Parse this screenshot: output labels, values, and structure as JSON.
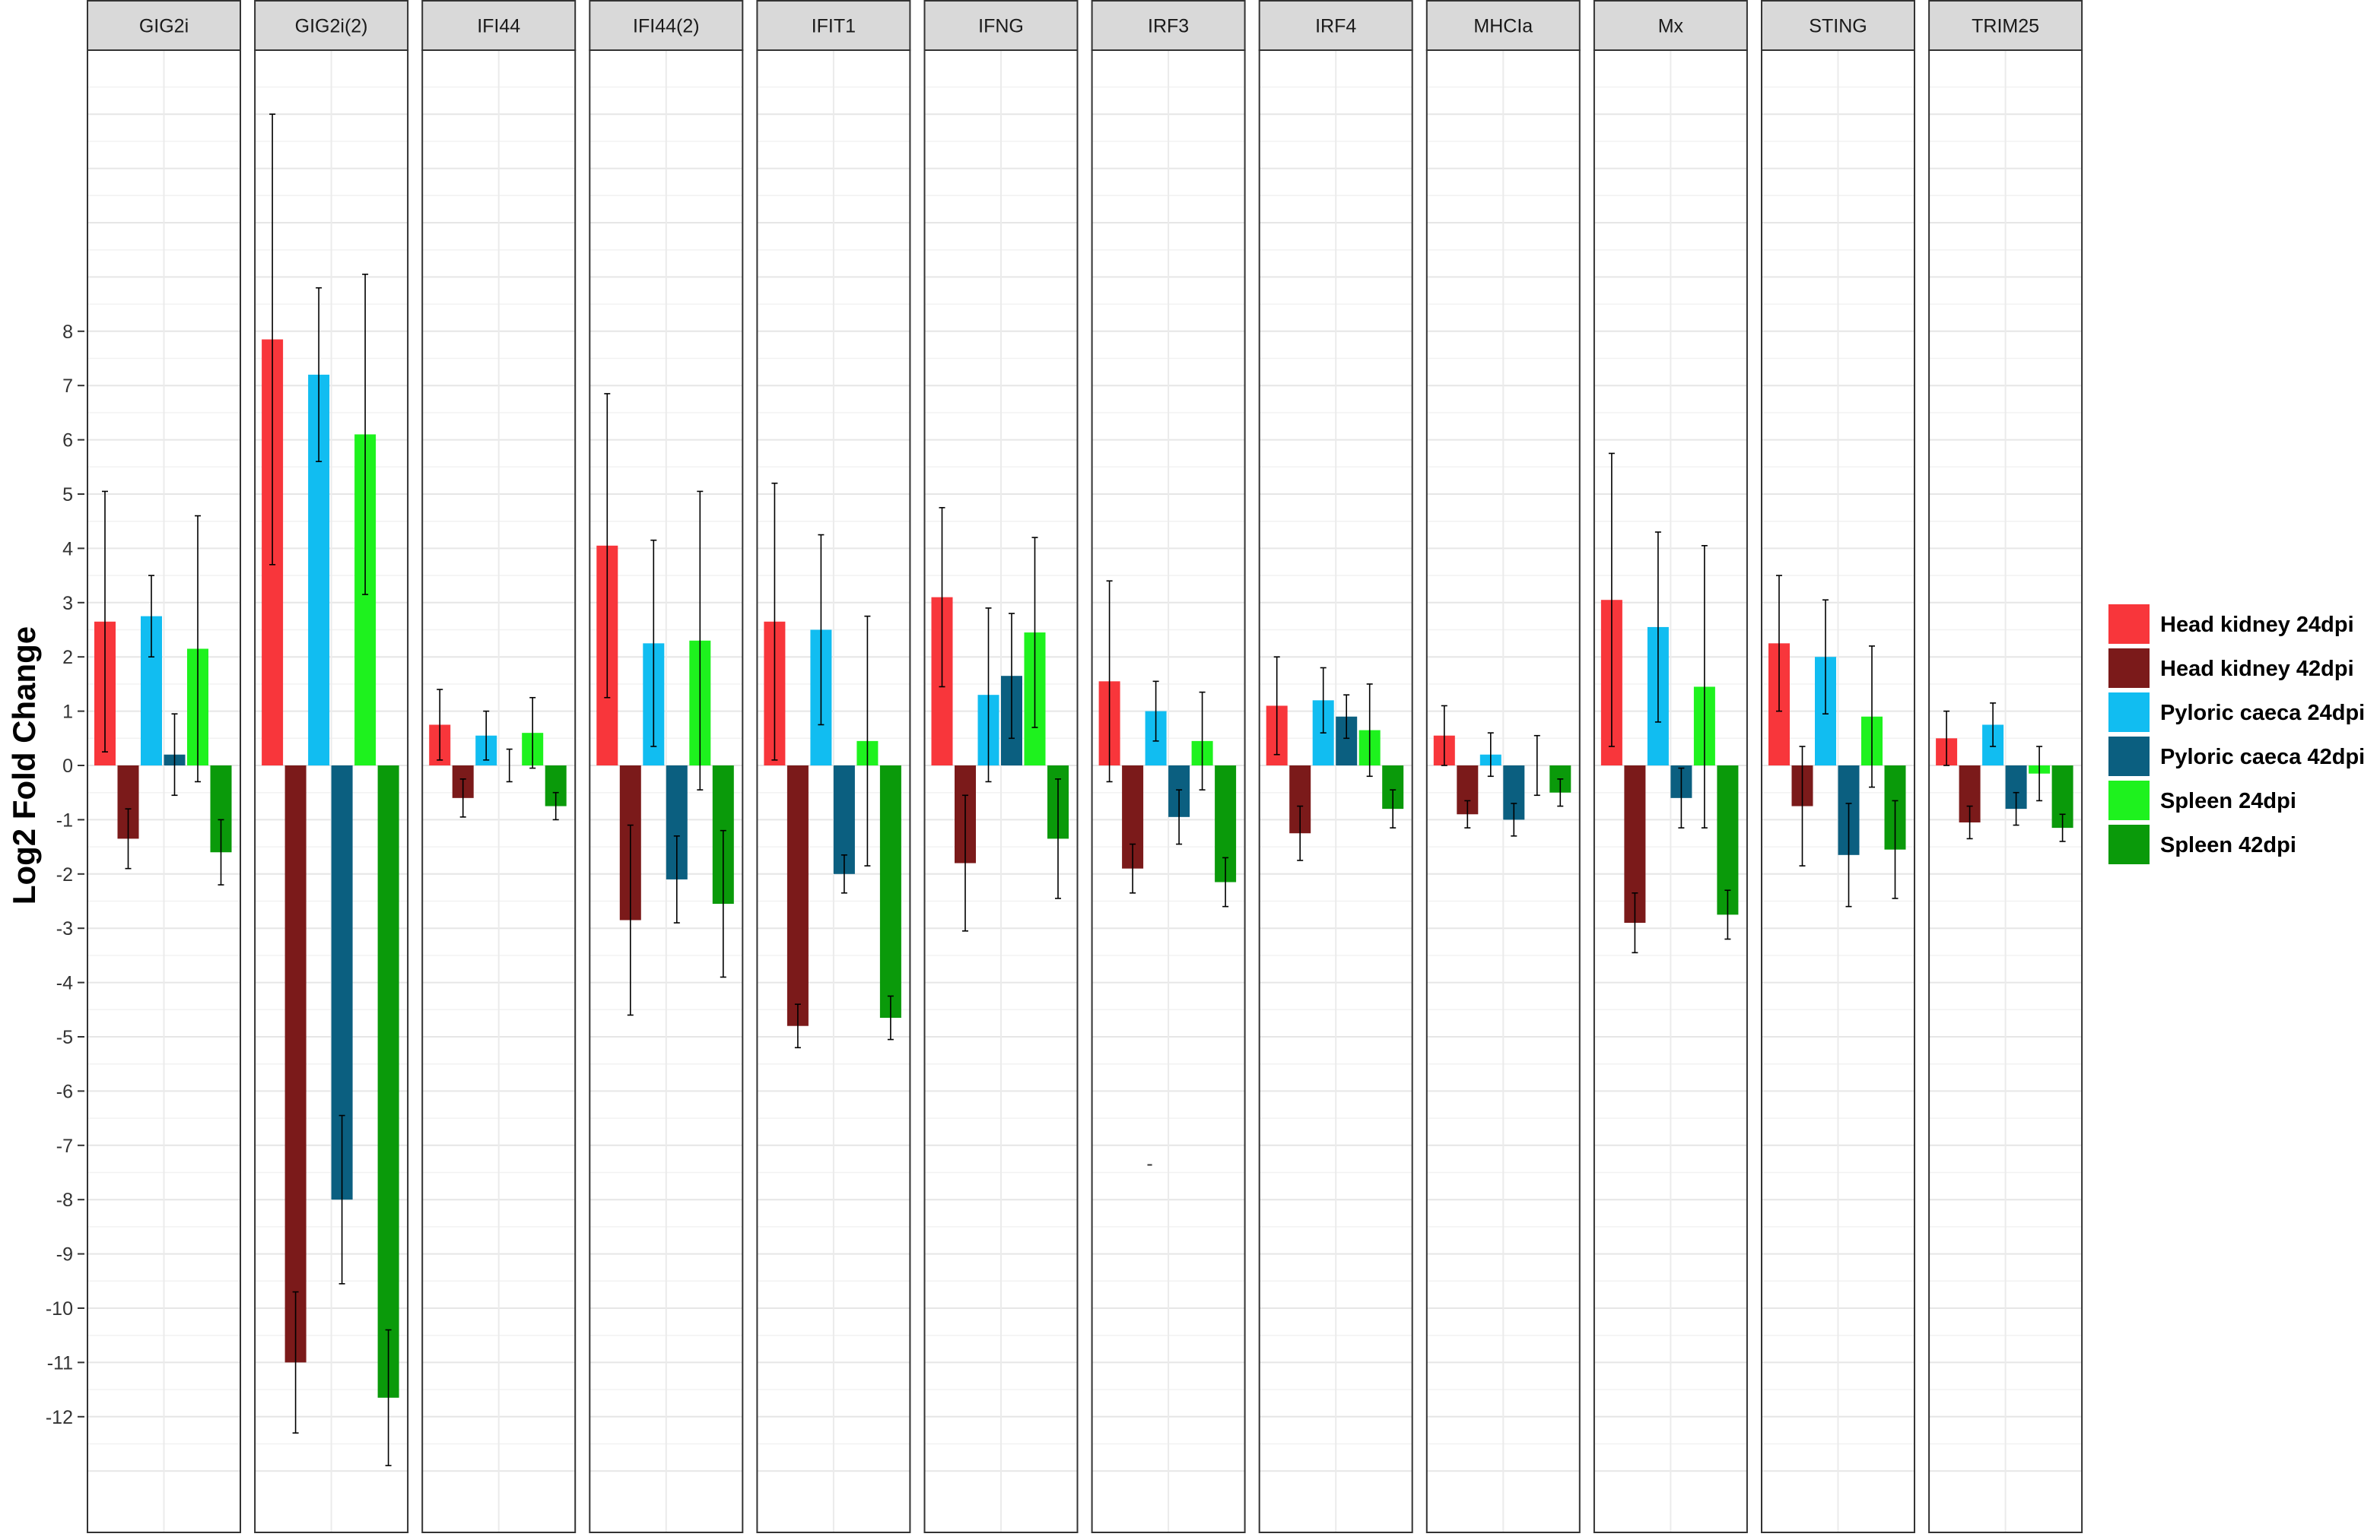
{
  "chart_data": {
    "type": "bar",
    "ylabel": "Log2 Fold Change",
    "ylim": [
      -13.6,
      12.4
    ],
    "y_ticks": [
      8,
      7,
      6,
      5,
      4,
      3,
      2,
      1,
      0,
      -1,
      -2,
      -3,
      -4,
      -5,
      -6,
      -7,
      -8,
      -9,
      -10,
      -11,
      -12
    ],
    "grid": true,
    "legend_position": "right",
    "facets": [
      "GIG2i",
      "GIG2i(2)",
      "IFI44",
      "IFI44(2)",
      "IFIT1",
      "IFNG",
      "IRF3",
      "IRF4",
      "MHCIa",
      "Mx",
      "STING",
      "TRIM25"
    ],
    "series": [
      {
        "name": "Head kidney 24dpi",
        "color": "#f8363b",
        "values": [
          2.65,
          7.85,
          0.75,
          4.05,
          2.65,
          3.1,
          1.55,
          1.1,
          0.55,
          3.05,
          2.25,
          0.5
        ],
        "err": [
          2.4,
          4.15,
          0.65,
          2.8,
          2.55,
          1.65,
          1.85,
          0.9,
          0.55,
          2.7,
          1.25,
          0.5
        ]
      },
      {
        "name": "Head kidney 42dpi",
        "color": "#7b1a1a",
        "values": [
          -1.35,
          -11.0,
          -0.6,
          -2.85,
          -4.8,
          -1.8,
          -1.9,
          -1.25,
          -0.9,
          -2.9,
          -0.75,
          -1.05
        ],
        "err": [
          0.55,
          1.3,
          0.35,
          1.75,
          0.4,
          1.25,
          0.45,
          0.5,
          0.25,
          0.55,
          1.1,
          0.3
        ]
      },
      {
        "name": "Pyloric caeca 24dpi",
        "color": "#11bdf1",
        "values": [
          2.75,
          7.2,
          0.55,
          2.25,
          2.5,
          1.3,
          1.0,
          1.2,
          0.2,
          2.55,
          2.0,
          0.75
        ],
        "err": [
          0.75,
          1.6,
          0.45,
          1.9,
          1.75,
          1.6,
          0.55,
          0.6,
          0.4,
          1.75,
          1.05,
          0.4
        ]
      },
      {
        "name": "Pyloric caeca 42dpi",
        "color": "#0b5f80",
        "values": [
          0.2,
          -8.0,
          null,
          -2.1,
          -2.0,
          1.65,
          -0.95,
          0.9,
          -1.0,
          -0.6,
          -1.65,
          -0.8
        ],
        "err": [
          0.75,
          1.55,
          null,
          0.8,
          0.35,
          1.15,
          0.5,
          0.4,
          0.3,
          0.55,
          0.95,
          0.3
        ]
      },
      {
        "name": "Spleen 24dpi",
        "color": "#1ef21e",
        "values": [
          2.15,
          6.1,
          0.6,
          2.3,
          0.45,
          2.45,
          0.45,
          0.65,
          null,
          1.45,
          0.9,
          -0.15
        ],
        "err": [
          2.45,
          2.95,
          0.65,
          2.75,
          2.3,
          1.75,
          0.9,
          0.85,
          null,
          2.6,
          1.3,
          0.5
        ]
      },
      {
        "name": "Spleen 42dpi",
        "color": "#0a9a0a",
        "values": [
          -1.6,
          -11.65,
          -0.75,
          -2.55,
          -4.65,
          -1.35,
          -2.15,
          -0.8,
          -0.5,
          -2.75,
          -1.55,
          -1.15
        ],
        "err": [
          0.6,
          1.25,
          0.25,
          1.35,
          0.4,
          1.1,
          0.45,
          0.35,
          0.25,
          0.45,
          0.9,
          0.25
        ]
      }
    ],
    "extra_errorbars": [
      {
        "facet": "IFI44",
        "center": 0.0,
        "err": 0.3
      },
      {
        "facet": "MHCIa",
        "center": 0.0,
        "err": 0.55
      }
    ],
    "annotations": [
      {
        "facet": "IRF3",
        "text": "-",
        "y": -7.35
      }
    ]
  }
}
